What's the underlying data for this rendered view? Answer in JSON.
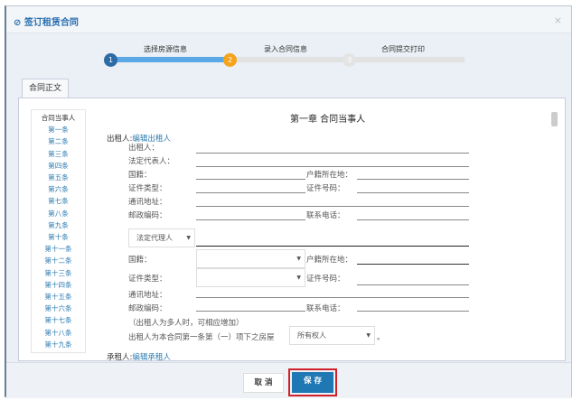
{
  "dialog": {
    "title": "签订租赁合同",
    "close": "×"
  },
  "steps": [
    {
      "num": "1",
      "label": "选择房源信息"
    },
    {
      "num": "2",
      "label": "录入合同信息"
    },
    {
      "num": "3",
      "label": "合同提交打印"
    }
  ],
  "tab": "合同正文",
  "toc": [
    "合同当事人",
    "第一条",
    "第二条",
    "第三条",
    "第四条",
    "第五条",
    "第六条",
    "第七条",
    "第八条",
    "第九条",
    "第十条",
    "第十一条",
    "第十二条",
    "第十三条",
    "第十四条",
    "第十五条",
    "第十六条",
    "第十七条",
    "第十八条",
    "第十九条"
  ],
  "chapter_title": "第一章 合同当事人",
  "lessor": {
    "heading": "出租人:",
    "edit_link": "编辑出租人",
    "labels": {
      "lessor": "出租人：",
      "legal_rep": "法定代表人：",
      "nationality": "国籍：",
      "household": "户籍所在地：",
      "id_type": "证件类型：",
      "id_no": "证件号码：",
      "address": "通讯地址：",
      "postcode": "邮政编码：",
      "phone": "联系电话："
    }
  },
  "agent": {
    "type_select": "法定代理人",
    "labels": {
      "nationality": "国籍：",
      "household": "户籍所在地：",
      "id_type": "证件类型：",
      "id_no": "证件号码：",
      "address": "通讯地址：",
      "postcode": "邮政编码：",
      "phone": "联系电话："
    }
  },
  "note": "（出租人为多人时，可相应增加）",
  "ownership_text": "出租人为本合同第一条第（一）项下之房屋",
  "ownership_select": "所有权人",
  "period": "。",
  "tenant": {
    "heading": "承租人:",
    "edit_link": "编辑承租人"
  },
  "buttons": {
    "cancel": "取 消",
    "save": "保 存"
  },
  "colors": {
    "accent": "#2a6fb0",
    "step_done": "#2d6aa6",
    "step_active": "#f5a31a",
    "save": "#1f78b4",
    "highlight": "#d0202a"
  }
}
